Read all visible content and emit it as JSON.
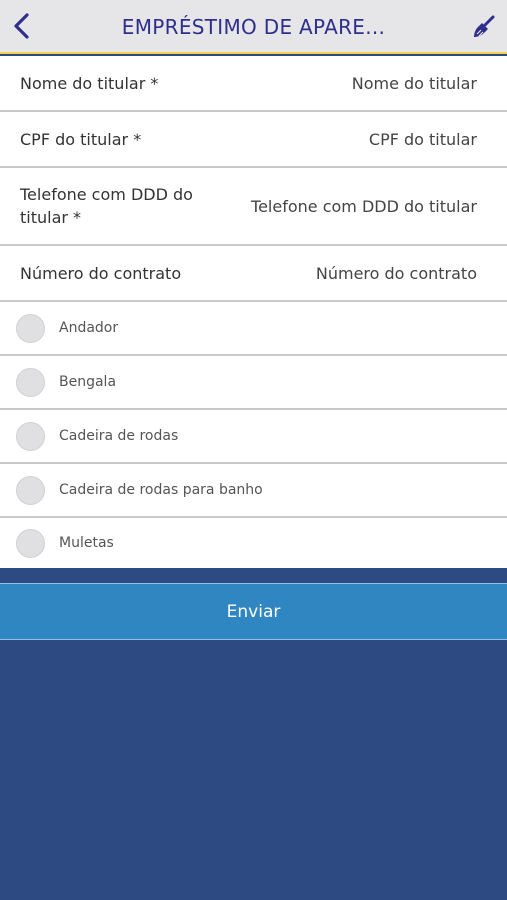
{
  "header": {
    "title": "EMPRÉSTIMO DE APARE...",
    "back_icon": "chevron-left-icon",
    "clear_icon": "broom-icon",
    "accent_color": "#2e2e8c",
    "underline_color": "#f0d34a"
  },
  "fields": [
    {
      "label": "Nome do titular *",
      "placeholder": "Nome do titular"
    },
    {
      "label": "CPF do titular *",
      "placeholder": "CPF do titular"
    },
    {
      "label": "Telefone com DDD do titular *",
      "placeholder": "Telefone com DDD do titular"
    },
    {
      "label": "Número do contrato",
      "placeholder": "Número do contrato"
    }
  ],
  "options": [
    {
      "label": "Andador",
      "selected": false
    },
    {
      "label": "Bengala",
      "selected": false
    },
    {
      "label": "Cadeira de rodas",
      "selected": false
    },
    {
      "label": "Cadeira de rodas para banho",
      "selected": false
    },
    {
      "label": "Muletas",
      "selected": false
    }
  ],
  "submit": {
    "label": "Enviar",
    "color": "#2f86c0"
  },
  "background_color": "#2e4a82"
}
